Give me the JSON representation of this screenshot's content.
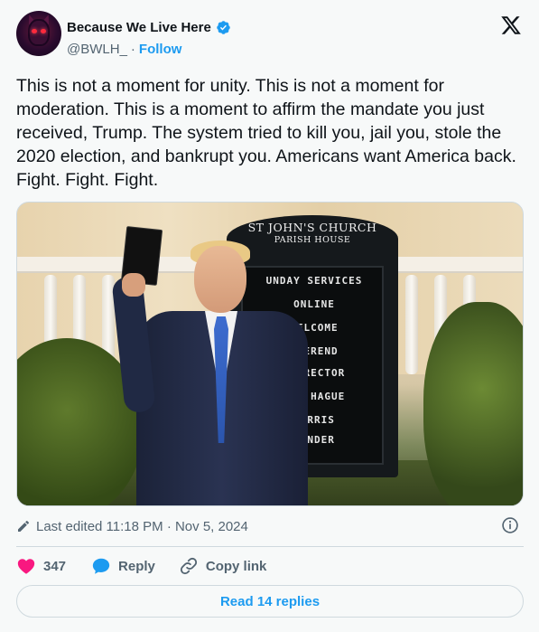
{
  "author": {
    "name": "Because We Live Here",
    "handle": "@BWLH_",
    "separator": "·",
    "follow_label": "Follow",
    "verified_icon": "verified-badge-icon",
    "avatar_icon": "devil-avatar"
  },
  "brand": {
    "logo_icon": "x-logo-icon"
  },
  "tweet": {
    "text": "This is not a moment for unity. This is not a moment for moderation. This is a moment to affirm the mandate you just received, Trump. The system tried to kill you, jail you, stole the 2020 election, and bankrupt you. Americans want America back. Fight. Fight. Fight."
  },
  "media": {
    "sign_title": "ST JOHN'S CHURCH",
    "sign_subtitle": "PARISH HOUSE",
    "sign_lines": [
      "UNDAY SERVICES",
      "ONLINE",
      "WELCOME",
      "EVEREND",
      "R. RECTOR",
      "KEN HAGUE",
      "NORRIS",
      "PONDER"
    ]
  },
  "meta": {
    "edited_label": "Last edited 11:18 PM · Nov 5, 2024",
    "edit_icon": "pencil-icon",
    "info_icon": "info-icon"
  },
  "actions": {
    "likes_count": "347",
    "reply_label": "Reply",
    "copy_link_label": "Copy link",
    "like_icon": "heart-icon",
    "reply_icon": "speech-bubble-icon",
    "link_icon": "link-icon"
  },
  "replies_button": {
    "label": "Read 14 replies"
  },
  "colors": {
    "accent": "#1d9bf0",
    "heart": "#f91880",
    "text": "#0f1419",
    "muted": "#536471",
    "border": "#cfd9de"
  }
}
